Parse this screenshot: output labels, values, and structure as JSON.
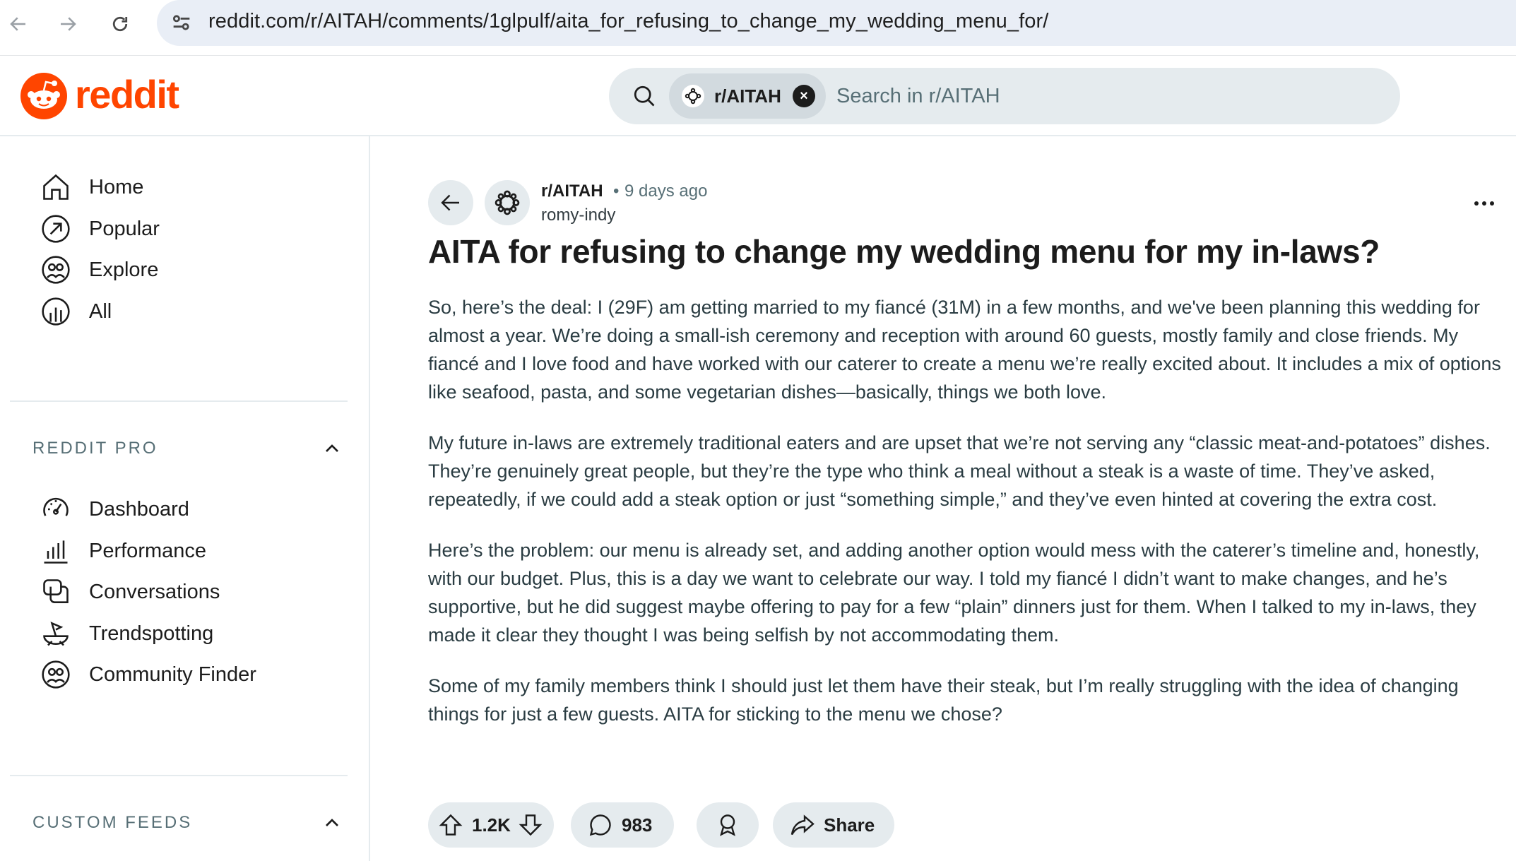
{
  "browser": {
    "url": "reddit.com/r/AITAH/comments/1glpulf/aita_for_refusing_to_change_my_wedding_menu_for/"
  },
  "header": {
    "logo_text": "reddit",
    "search": {
      "chip_label": "r/AITAH",
      "placeholder": "Search in r/AITAH"
    }
  },
  "sidebar": {
    "items": [
      {
        "label": "Home",
        "icon": "home-icon"
      },
      {
        "label": "Popular",
        "icon": "popular-icon"
      },
      {
        "label": "Explore",
        "icon": "explore-icon"
      },
      {
        "label": "All",
        "icon": "all-icon"
      }
    ],
    "reddit_pro": {
      "title": "REDDIT PRO",
      "items": [
        {
          "label": "Dashboard",
          "icon": "dashboard-icon"
        },
        {
          "label": "Performance",
          "icon": "performance-icon"
        },
        {
          "label": "Conversations",
          "icon": "conversations-icon"
        },
        {
          "label": "Trendspotting",
          "icon": "trendspotting-icon"
        },
        {
          "label": "Community Finder",
          "icon": "community-finder-icon"
        }
      ]
    },
    "custom_feeds": {
      "title": "CUSTOM FEEDS"
    }
  },
  "post": {
    "subreddit": "r/AITAH",
    "separator": "•",
    "time": "9 days ago",
    "author": "romy-indy",
    "title": "AITA for refusing to change my wedding menu for my in-laws?",
    "paragraphs": [
      "So, here’s the deal: I (29F) am getting married to my fiancé (31M) in a few months, and we've been planning this wedding for almost a year. We’re doing a small-ish ceremony and reception with around 60 guests, mostly family and close friends. My fiancé and I love food and have worked with our caterer to create a menu we’re really excited about. It includes a mix of options like seafood, pasta, and some vegetarian dishes—basically, things we both love.",
      "My future in-laws are extremely traditional eaters and are upset that we’re not serving any “classic meat-and-potatoes” dishes. They’re genuinely great people, but they’re the type who think a meal without a steak is a waste of time. They’ve asked, repeatedly, if we could add a steak option or just “something simple,” and they’ve even hinted at covering the extra cost.",
      "Here’s the problem: our menu is already set, and adding another option would mess with the caterer’s timeline and, honestly, with our budget. Plus, this is a day we want to celebrate our way. I told my fiancé I didn’t want to make changes, and he’s supportive, but he did suggest maybe offering to pay for a few “plain” dinners just for them. When I talked to my in-laws, they made it clear they thought I was being selfish by not accommodating them.",
      "Some of my family members think I should just let them have their steak, but I’m really struggling with the idea of changing things for just a few guests. AITA for sticking to the menu we chose?"
    ],
    "actions": {
      "votes": "1.2K",
      "comments": "983",
      "share_label": "Share"
    }
  },
  "colors": {
    "brand": "#ff4500",
    "pill_bg": "#e5ebee",
    "url_bar_bg": "#e9eef6"
  }
}
